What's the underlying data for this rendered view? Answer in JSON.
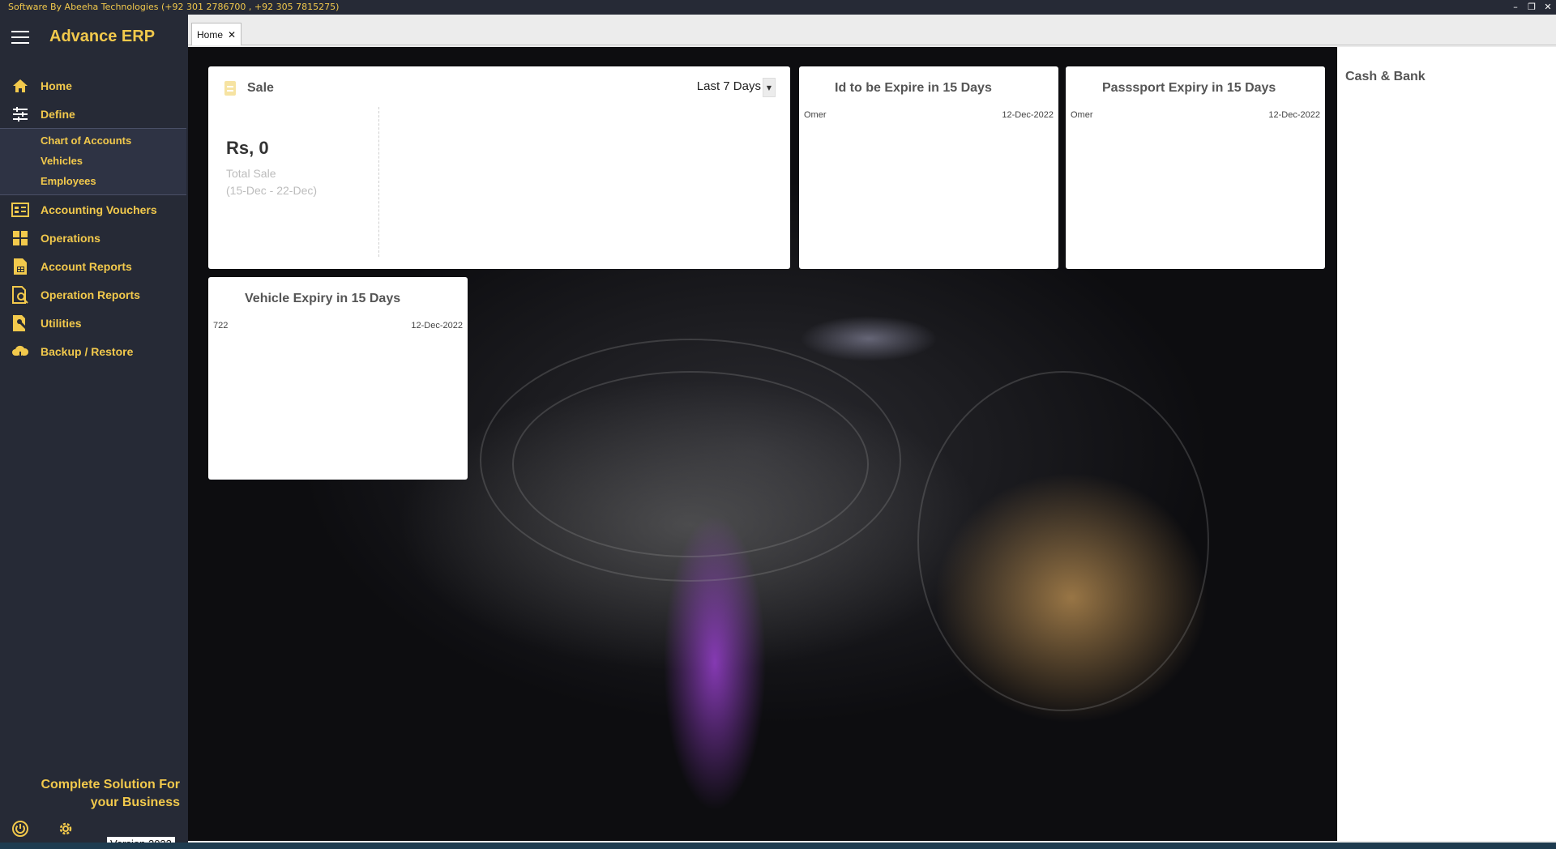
{
  "titlebar": {
    "text": "Software By Abeeha Technologies (+92 301 2786700 , +92 305 7815275)",
    "minimize": "–",
    "restore": "❐",
    "close": "✕"
  },
  "sidebar": {
    "brand": "Advance ERP",
    "items": [
      {
        "label": "Home",
        "icon": "home-icon"
      },
      {
        "label": "Define",
        "icon": "sliders-icon"
      },
      {
        "label": "Accounting Vouchers",
        "icon": "voucher-icon"
      },
      {
        "label": "Operations",
        "icon": "operations-icon"
      },
      {
        "label": "Account Reports",
        "icon": "report-icon"
      },
      {
        "label": "Operation Reports",
        "icon": "search-report-icon"
      },
      {
        "label": "Utilities",
        "icon": "utilities-icon"
      },
      {
        "label": "Backup / Restore",
        "icon": "cloud-icon"
      }
    ],
    "submenu": [
      "Chart of Accounts",
      "Vehicles",
      "Employees"
    ],
    "tagline_line1": "Complete Solution For",
    "tagline_line2": "your Business",
    "version": "Version 2022"
  },
  "tabs": [
    {
      "label": "Home",
      "close": "✕"
    }
  ],
  "sale": {
    "title": "Sale",
    "period": "Last 7 Days",
    "amount": "Rs, 0",
    "caption": "Total Sale",
    "range": "(15-Dec - 22-Dec)"
  },
  "id_expiry": {
    "title": "Id to be Expire in 15 Days",
    "rows": [
      {
        "name": "Omer",
        "date": "12-Dec-2022"
      }
    ]
  },
  "passport_expiry": {
    "title": "Passsport Expiry in 15 Days",
    "rows": [
      {
        "name": "Omer",
        "date": "12-Dec-2022"
      }
    ]
  },
  "vehicle_expiry": {
    "title": "Vehicle Expiry in 15 Days",
    "rows": [
      {
        "name": "722",
        "date": "12-Dec-2022"
      }
    ]
  },
  "cash_bank": {
    "title": "Cash & Bank"
  }
}
